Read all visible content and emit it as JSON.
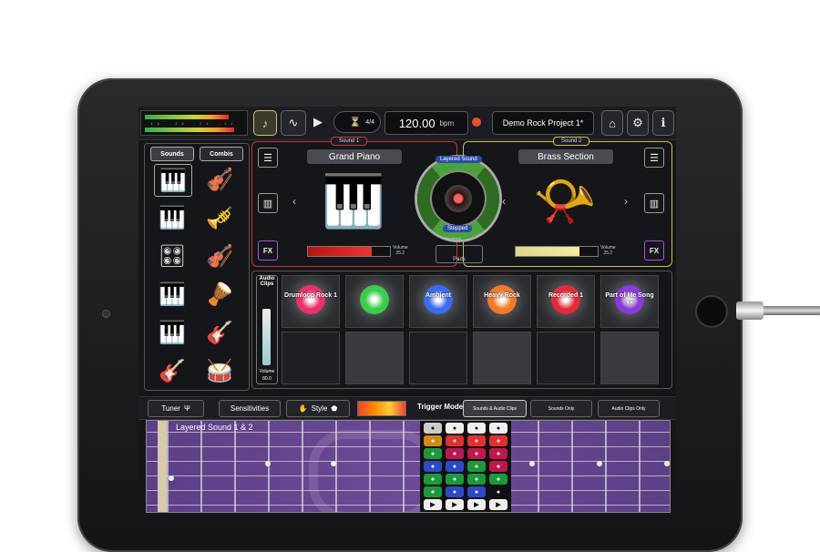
{
  "topbar": {
    "meter_ticks": "-48 -36 -24 -12 -6 0",
    "time_signature": "4/4",
    "bpm_value": "120.00",
    "bpm_unit": "bpm",
    "project_name": "Demo Rock Project 1*"
  },
  "left_panel": {
    "tabs": [
      "Sounds",
      "Combis"
    ],
    "instruments": [
      {
        "name": "grand-piano-icon",
        "glyph": "🎹"
      },
      {
        "name": "violin-icon",
        "glyph": "🎻"
      },
      {
        "name": "upright-piano-icon",
        "glyph": "🎹"
      },
      {
        "name": "brass-icon",
        "glyph": "🎺"
      },
      {
        "name": "organ-icon",
        "glyph": "🎛"
      },
      {
        "name": "strings-icon",
        "glyph": "🎻"
      },
      {
        "name": "synth-icon",
        "glyph": "🎹"
      },
      {
        "name": "mallets-icon",
        "glyph": "🪘"
      },
      {
        "name": "keyboard-icon",
        "glyph": "🎹"
      },
      {
        "name": "electric-guitar-icon",
        "glyph": "🎸"
      },
      {
        "name": "acoustic-guitar-icon",
        "glyph": "🎸"
      },
      {
        "name": "drums-icon",
        "glyph": "🥁"
      }
    ]
  },
  "sound1": {
    "label": "Sound 1",
    "name": "Grand Piano",
    "volume_label": "Volume",
    "volume_value": "25.2",
    "volume_fraction": 0.78,
    "fx_label": "FX"
  },
  "sound2": {
    "label": "Sound 2",
    "name": "Brass Section",
    "volume_label": "Volume",
    "volume_value": "25.2",
    "volume_fraction": 0.78,
    "fx_label": "FX"
  },
  "dial": {
    "top_label": "Layered Sound",
    "bottom_label": "Stepped",
    "bottom_sub": "Pitchbend",
    "pads_label": "Pads"
  },
  "audio_clips": {
    "label_line1": "Audio",
    "label_line2": "Clips",
    "volume_label": "Volume",
    "volume_value": "80.0",
    "clips": [
      {
        "title": "Drumloop Rock 1",
        "color": "#e8306a"
      },
      {
        "title": "",
        "color": "#3acd4a"
      },
      {
        "title": "Ambient",
        "color": "#3a6cf0"
      },
      {
        "title": "Heavy Rock",
        "color": "#f07a28"
      },
      {
        "title": "Recorded 1",
        "color": "#e62a3a"
      },
      {
        "title": "Part of Me Song v1",
        "color": "#8a3ad8"
      }
    ]
  },
  "strip": {
    "tuner_label": "Tuner",
    "sensitivities_label": "Sensitivities",
    "style_label": "Style",
    "trigger_mode_label": "Trigger Mode",
    "modes": [
      "Sounds & Audio Clips",
      "Sounds Only",
      "Audio Clips Only"
    ]
  },
  "fretboard": {
    "label": "Layered Sound 1 & 2"
  }
}
